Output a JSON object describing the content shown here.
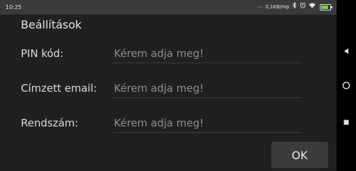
{
  "status_bar": {
    "time": "10:25",
    "network_speed": "0,1KB/mp",
    "battery_level": 0.83,
    "icons": [
      "dots-icon",
      "bluetooth-icon",
      "alarm-icon",
      "wifi-icon",
      "battery-icon"
    ]
  },
  "dialog": {
    "title": "Beállítások",
    "fields": [
      {
        "label": "PIN kód:",
        "value": "",
        "placeholder": "Kérem adja meg!"
      },
      {
        "label": "Címzett email:",
        "value": "",
        "placeholder": "Kérem adja meg!"
      },
      {
        "label": "Rendszám:",
        "value": "",
        "placeholder": "Kérem adja meg!"
      }
    ],
    "ok_label": "OK"
  },
  "nav_bar": {
    "icons": [
      "back-icon",
      "home-icon",
      "recent-apps-icon"
    ]
  },
  "colors": {
    "dialog_background": "#202020",
    "status_bar_background": "#3a3a3a",
    "button_background": "#3b3b3b",
    "battery_fill": "#7dd14a"
  }
}
